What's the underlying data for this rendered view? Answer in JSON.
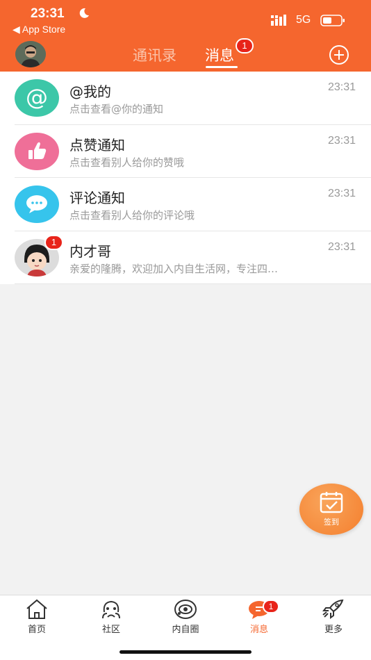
{
  "status_bar": {
    "time": "23:31",
    "back_label": "◀ App Store",
    "network": "5G"
  },
  "header": {
    "tabs": [
      {
        "label": "通讯录"
      },
      {
        "label": "消息",
        "badge": "1"
      }
    ]
  },
  "messages": [
    {
      "title": "@我的",
      "subtitle": "点击查看@你的通知",
      "time": "23:31",
      "icon": "at-icon",
      "color": "#3cc7a8"
    },
    {
      "title": "点赞通知",
      "subtitle": "点击查看别人给你的赞哦",
      "time": "23:31",
      "icon": "thumbs-up-icon",
      "color": "#ef6f98"
    },
    {
      "title": "评论通知",
      "subtitle": "点击查看别人给你的评论哦",
      "time": "23:31",
      "icon": "comment-icon",
      "color": "#36c4ec"
    },
    {
      "title": "内才哥",
      "subtitle": "亲爱的隆腾，欢迎加入内自生活网，专注四…",
      "time": "23:31",
      "icon": "user-avatar",
      "badge": "1"
    }
  ],
  "sign_button": {
    "label": "签到"
  },
  "tabbar": [
    {
      "label": "首页",
      "icon": "home-icon"
    },
    {
      "label": "社区",
      "icon": "community-icon"
    },
    {
      "label": "内自圈",
      "icon": "circle-eye-icon"
    },
    {
      "label": "消息",
      "icon": "message-icon",
      "badge": "1",
      "active": true
    },
    {
      "label": "更多",
      "icon": "rocket-icon"
    }
  ],
  "colors": {
    "brand": "#f5662e",
    "badge": "#e8241a"
  }
}
